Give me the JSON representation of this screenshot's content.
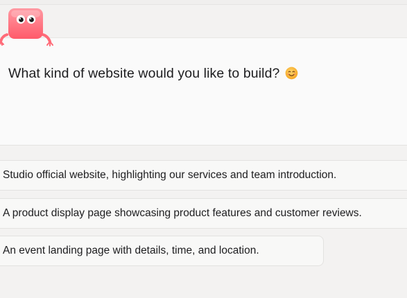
{
  "prompt": {
    "question": "What kind of website would you like to build?",
    "emoji_icon": "smiling-face-emoji"
  },
  "mascot": {
    "icon": "pink-robot-mascot-icon",
    "color": "#ff6b78"
  },
  "suggestions": [
    {
      "label": "Studio official website, highlighting our services and team introduction."
    },
    {
      "label": "A product display page showcasing product features and customer reviews."
    },
    {
      "label": "An event landing page with details, time, and location."
    }
  ]
}
